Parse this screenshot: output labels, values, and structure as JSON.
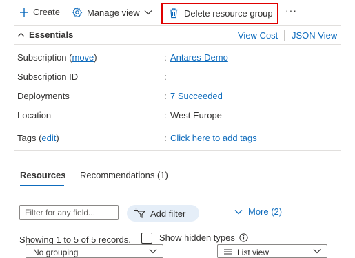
{
  "toolbar": {
    "create_label": "Create",
    "manage_view_label": "Manage view",
    "delete_label": "Delete resource group",
    "more_label": "···"
  },
  "essentials": {
    "title": "Essentials",
    "view_cost": "View Cost",
    "json_view": "JSON View",
    "rows": [
      {
        "label": "Subscription (",
        "link": "move",
        "label_end": ")",
        "value": "Antares-Demo"
      },
      {
        "label": "Subscription ID",
        "value": ""
      },
      {
        "label": "Deployments",
        "value": "7 Succeeded"
      },
      {
        "label": "Location",
        "value": "West Europe"
      },
      {
        "label": "Tags (",
        "link": "edit",
        "label_end": ")",
        "value": "Click here to add tags"
      }
    ],
    "colon": ":"
  },
  "tabs": [
    {
      "label": "Resources",
      "active": true
    },
    {
      "label": "Recommendations (1)",
      "active": false
    }
  ],
  "filters": {
    "placeholder": "Filter for any field...",
    "add_filter": "Add filter",
    "more": "More (2)"
  },
  "records": {
    "showing": "Showing 1 to 5 of 5 records.",
    "show_hidden": "Show hidden types",
    "grouping": "No grouping",
    "view": "List view"
  },
  "colors": {
    "accent": "#0f6cbd",
    "highlight": "#e00000",
    "pill": "#e5eef8"
  }
}
